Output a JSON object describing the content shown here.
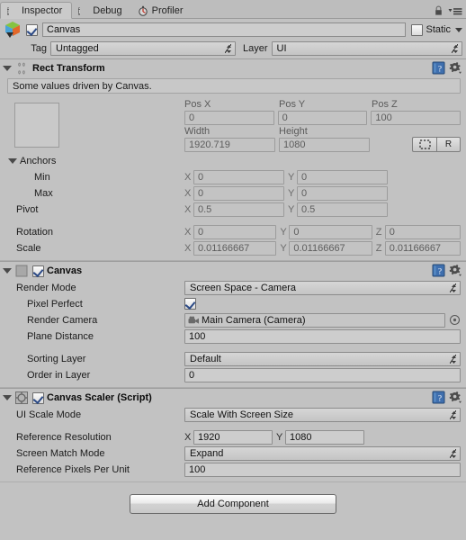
{
  "window": {
    "tabs": [
      {
        "label": "Inspector",
        "icon": "info-icon",
        "active": true
      },
      {
        "label": "Debug",
        "icon": "info-icon",
        "active": false
      },
      {
        "label": "Profiler",
        "icon": "profiler-icon",
        "active": false
      }
    ],
    "lock_icon": "lock-icon",
    "menu_icon": "hamburger-menu-icon"
  },
  "object": {
    "icon": "gameobject-cube-icon",
    "enabled": true,
    "name": "Canvas",
    "static_label": "Static",
    "static_checked": false,
    "tag_label": "Tag",
    "tag_value": "Untagged",
    "layer_label": "Layer",
    "layer_value": "UI"
  },
  "rect_transform": {
    "title": "Rect Transform",
    "icon": "rect-transform-icon",
    "info_message": "Some values driven by Canvas.",
    "pos_x_label": "Pos X",
    "pos_y_label": "Pos Y",
    "pos_z_label": "Pos Z",
    "pos_x": "0",
    "pos_y": "0",
    "pos_z": "100",
    "width_label": "Width",
    "height_label": "Height",
    "width": "1920.719",
    "height": "1080",
    "blueprint_btn": "blueprint-mode-icon",
    "raw_btn": "R",
    "anchors_label": "Anchors",
    "min_label": "Min",
    "max_label": "Max",
    "pivot_label": "Pivot",
    "rotation_label": "Rotation",
    "scale_label": "Scale",
    "axis_x": "X",
    "axis_y": "Y",
    "axis_z": "Z",
    "anchor_min_x": "0",
    "anchor_min_y": "0",
    "anchor_max_x": "0",
    "anchor_max_y": "0",
    "pivot_x": "0.5",
    "pivot_y": "0.5",
    "rotation_x": "0",
    "rotation_y": "0",
    "rotation_z": "0",
    "scale_x": "0.01166667",
    "scale_y": "0.01166667",
    "scale_z": "0.01166667"
  },
  "canvas": {
    "title": "Canvas",
    "icon": "canvas-icon",
    "enabled": true,
    "render_mode_label": "Render Mode",
    "render_mode_value": "Screen Space - Camera",
    "pixel_perfect_label": "Pixel Perfect",
    "pixel_perfect_checked": true,
    "render_camera_label": "Render Camera",
    "render_camera_value": "Main Camera (Camera)",
    "render_camera_icon": "camera-icon",
    "plane_distance_label": "Plane Distance",
    "plane_distance_value": "100",
    "sorting_layer_label": "Sorting Layer",
    "sorting_layer_value": "Default",
    "order_in_layer_label": "Order in Layer",
    "order_in_layer_value": "0"
  },
  "canvas_scaler": {
    "title": "Canvas Scaler (Script)",
    "icon": "script-icon",
    "enabled": true,
    "ui_scale_mode_label": "UI Scale Mode",
    "ui_scale_mode_value": "Scale With Screen Size",
    "reference_resolution_label": "Reference Resolution",
    "ref_res_x_axis": "X",
    "ref_res_y_axis": "Y",
    "reference_resolution_x": "1920",
    "reference_resolution_y": "1080",
    "screen_match_mode_label": "Screen Match Mode",
    "screen_match_mode_value": "Expand",
    "reference_ppu_label": "Reference Pixels Per Unit",
    "reference_ppu_value": "100"
  },
  "footer": {
    "add_component_label": "Add Component"
  },
  "colors": {
    "background": "#c2c2c2",
    "field": "#cdcdcd",
    "accent_check": "#2c4a86"
  }
}
